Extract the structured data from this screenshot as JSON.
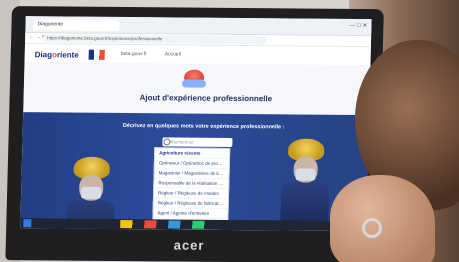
{
  "browser": {
    "tab_label": "Diagoriente",
    "url": "https://diagoriente.beta.gouv.fr/experience/professionnelle",
    "window_controls": "— □ ✕",
    "nav_icons": "← → ⟳"
  },
  "site": {
    "logo_text_main": "Diag",
    "logo_text_accent": "o",
    "logo_text_rest": "riente",
    "nav": [
      "beta.gouv.fr",
      "Accueil"
    ]
  },
  "hero": {
    "title": "Ajout d'expérience professionnelle"
  },
  "banner": {
    "prompt": "Décrivez en quelques mots votre expérience professionnelle :",
    "search_placeholder": "Rechercher"
  },
  "dropdown": {
    "items": [
      "Agriculture récente",
      "Opérateur / Opératrice de production",
      "Magasinier / Magasinière de bureau",
      "Responsable de la réalisation d'ouvrage",
      "Régleur / Régleuse de moules",
      "Régleur / Régleuse de fabrication",
      "Agent / Agente d'entretien",
      "Assistant / Assistante de foyer"
    ]
  },
  "laptop": {
    "brand": "acer"
  },
  "colors": {
    "primary": "#1b2f8a",
    "accent": "#e84e3c",
    "banner": "#2d4c9b"
  },
  "icons": {
    "search": "search-icon",
    "badge": "helmet-badge-icon"
  }
}
